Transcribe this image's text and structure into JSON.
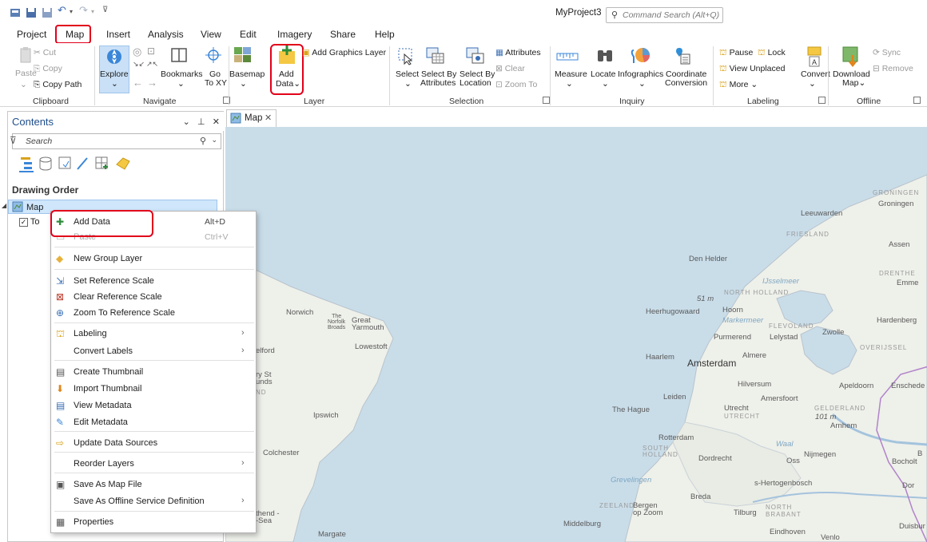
{
  "app": {
    "title": "MyProject3",
    "command_search_placeholder": "Command Search (Alt+Q)"
  },
  "tabs": [
    "Project",
    "Map",
    "Insert",
    "Analysis",
    "View",
    "Edit",
    "Imagery",
    "Share",
    "Help"
  ],
  "ribbon": {
    "clipboard": {
      "paste": "Paste",
      "cut": "Cut",
      "copy": "Copy",
      "copy_path": "Copy Path",
      "group": "Clipboard"
    },
    "navigate": {
      "explore": "Explore",
      "bookmarks": "Bookmarks",
      "go_to_xy_1": "Go",
      "go_to_xy_2": "To XY",
      "group": "Navigate"
    },
    "layer": {
      "basemap": "Basemap",
      "add_data_1": "Add",
      "add_data_2": "Data",
      "add_graphics_layer": "Add Graphics Layer",
      "group": "Layer"
    },
    "selection": {
      "select": "Select",
      "select_by_attributes_1": "Select By",
      "select_by_attributes_2": "Attributes",
      "select_by_location_1": "Select By",
      "select_by_location_2": "Location",
      "attributes": "Attributes",
      "clear": "Clear",
      "zoom_to": "Zoom To",
      "group": "Selection"
    },
    "inquiry": {
      "measure": "Measure",
      "locate": "Locate",
      "infographics": "Infographics",
      "coordinate_conversion_1": "Coordinate",
      "coordinate_conversion_2": "Conversion",
      "group": "Inquiry"
    },
    "labeling": {
      "pause": "Pause",
      "lock": "Lock",
      "view_unplaced": "View Unplaced",
      "more": "More",
      "convert": "Convert",
      "group": "Labeling"
    },
    "offline": {
      "download_map_1": "Download",
      "download_map_2": "Map",
      "sync": "Sync",
      "remove": "Remove",
      "group": "Offline"
    }
  },
  "contents": {
    "title": "Contents",
    "search_placeholder": "Search",
    "drawing_order": "Drawing Order",
    "map_item": "Map",
    "topo_item": "To"
  },
  "map_tab": {
    "label": "Map"
  },
  "context_menu": [
    {
      "label": "Add Data",
      "shortcut": "Alt+D",
      "icon": "add-data-icon"
    },
    {
      "label": "Paste",
      "shortcut": "Ctrl+V",
      "icon": "paste-icon",
      "disabled": true
    },
    {
      "label": "New Group Layer",
      "icon": "group-layer-icon"
    },
    {
      "label": "Set Reference Scale",
      "icon": "reference-scale-icon"
    },
    {
      "label": "Clear Reference Scale",
      "icon": "clear-scale-icon"
    },
    {
      "label": "Zoom To Reference Scale",
      "icon": "zoom-scale-icon"
    },
    {
      "label": "Labeling",
      "submenu": true,
      "icon": "labeling-icon"
    },
    {
      "label": "Convert Labels",
      "submenu": true
    },
    {
      "label": "Create Thumbnail",
      "icon": "thumbnail-icon"
    },
    {
      "label": "Import Thumbnail",
      "icon": "import-icon"
    },
    {
      "label": "View Metadata",
      "icon": "metadata-icon"
    },
    {
      "label": "Edit Metadata",
      "icon": "edit-icon"
    },
    {
      "label": "Update Data Sources",
      "icon": "update-sources-icon"
    },
    {
      "label": "Reorder Layers",
      "submenu": true
    },
    {
      "label": "Save As Map File",
      "icon": "save-map-icon"
    },
    {
      "label": "Save As Offline Service Definition",
      "submenu": true
    },
    {
      "label": "Properties",
      "icon": "properties-icon"
    }
  ],
  "map_labels": {
    "groningen_region": "GRONINGEN",
    "groningen": "Groningen",
    "leeuwarden": "Leeuwarden",
    "friesland": "FRIESLAND",
    "assen": "Assen",
    "drenthe": "DRENTHE",
    "emmen": "Emme",
    "den_helder": "Den Helder",
    "ijsselmeer": "IJsselmeer",
    "north_holland": "NORTH\nHOLLAND",
    "elev_51": "51 m",
    "heerhugowaard": "Heerhugowaard",
    "hoorn": "Hoorn",
    "markermeer": "Markermeer",
    "flevoland": "FLEVOLAND",
    "zwolle": "Zwolle",
    "hardenberg": "Hardenberg",
    "purmerend": "Purmerend",
    "lelystad": "Lelystad",
    "overijssel": "OVERIJSSEL",
    "haarlem": "Haarlem",
    "almere": "Almere",
    "amsterdam": "Amsterdam",
    "hilversum": "Hilversum",
    "apeldoorn": "Apeldoorn",
    "enschede": "Enschede",
    "leiden": "Leiden",
    "amersfoort": "Amersfoort",
    "the_hague": "The Hague",
    "utrecht": "Utrecht",
    "utrecht_region": "UTRECHT",
    "gelderland": "GELDERLAND",
    "elev_101": "101 m",
    "arnhem": "Arnhem",
    "rotterdam": "Rotterdam",
    "south_holland": "SOUTH\nHOLLAND",
    "waal": "Waal",
    "dordrecht": "Dordrecht",
    "oss": "Oss",
    "nijmegen": "Nijmegen",
    "bocholt": "Bocholt",
    "grevelingen": "Grevelingen",
    "s_hertogenbosch": "s-Hertogenbosch",
    "breda": "Breda",
    "zeeland": "ZEELAND",
    "bergen": "Bergen\nop Zoom",
    "tilburg": "Tilburg",
    "north_brabant": "NORTH\nBRABANT",
    "middelburg": "Middelburg",
    "eindhoven": "Eindhoven",
    "venlo": "Venlo",
    "duisburg": "Duisbur",
    "norwich": "Norwich",
    "norfolk": "The\nNorfolk\nBroads",
    "great_yarmouth": "Great\nYarmouth",
    "lowestoft": "Lowestoft",
    "ipswich": "Ipswich",
    "colchester": "Colchester",
    "margate": "Margate",
    "southend": "thend -\n-Sea",
    "bury": "ry St\nunds",
    "elford": "elford",
    "nd": "ND",
    "dor": "Dor",
    "b1": "B"
  },
  "colors": {
    "accent_red": "#e2001a",
    "selection_blue": "#cfe6fb",
    "sea": "#c9dde9",
    "land": "#eef0ea"
  }
}
